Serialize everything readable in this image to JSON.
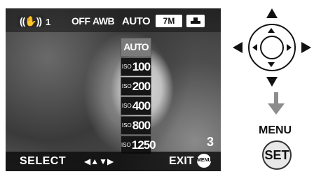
{
  "screen": {
    "top_indicators": {
      "stabilizer_label": "((✋))",
      "stabilizer_mode": "1",
      "flash": "OFF",
      "white_balance": "AWB",
      "iso": "AUTO",
      "picture_size": "7M",
      "quality_icon": "quality-icon"
    },
    "iso_menu": {
      "items": [
        {
          "prefix": "",
          "value": "AUTO"
        },
        {
          "prefix": "ISO",
          "value": "100"
        },
        {
          "prefix": "ISO",
          "value": "200"
        },
        {
          "prefix": "ISO",
          "value": "400"
        },
        {
          "prefix": "ISO",
          "value": "800"
        },
        {
          "prefix": "ISO",
          "value": "1250"
        }
      ],
      "selected_index": 0
    },
    "shots_remaining": "3",
    "bottom_bar": {
      "select_label": "SELECT",
      "select_icon": "◀▲▼▶",
      "exit_label": "EXIT",
      "exit_button_label": "MENU SET"
    }
  },
  "controls": {
    "dpad_icon": "cursor-buttons",
    "menu_label": "MENU",
    "set_label": "SET"
  }
}
